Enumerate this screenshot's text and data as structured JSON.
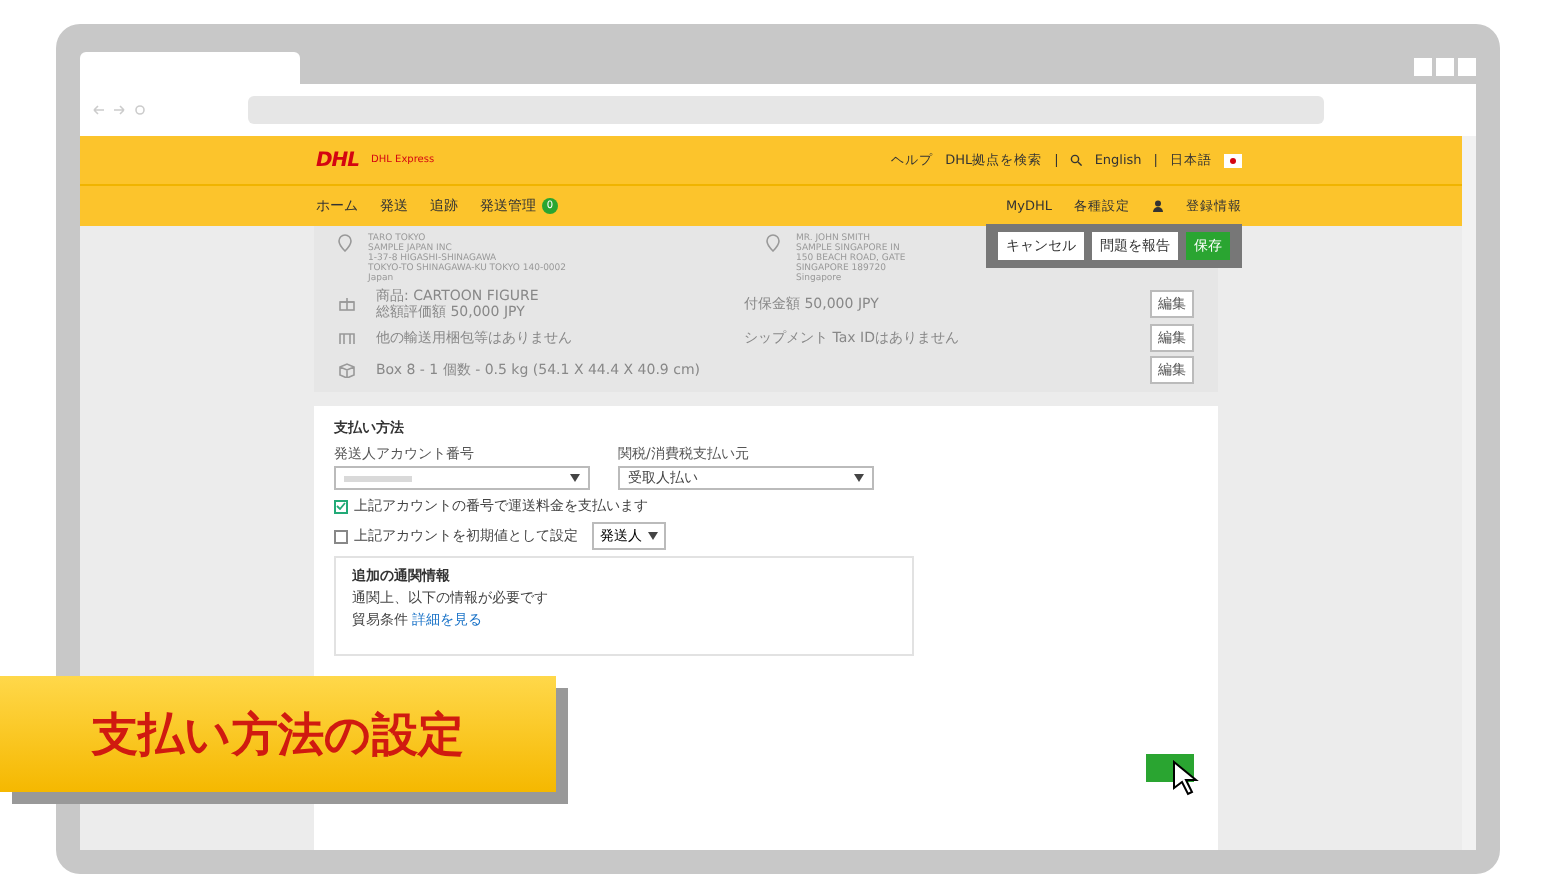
{
  "header": {
    "logo": "DHL",
    "brand": "DHL Express",
    "links": [
      {
        "text": "ヘルプ"
      },
      {
        "text": "DHL拠点を検索"
      },
      {
        "text": "|"
      },
      {
        "text": "English"
      },
      {
        "text": "|"
      },
      {
        "text": "日本語"
      }
    ]
  },
  "nav": {
    "items": [
      {
        "label": "ホーム"
      },
      {
        "label": "発送"
      },
      {
        "label": "追跡"
      },
      {
        "label": "発送管理",
        "badge": "0"
      }
    ],
    "right": [
      "MyDHL",
      "各種設定",
      "登録情報"
    ]
  },
  "actions": [
    {
      "label": "キャンセル",
      "kind": "plain"
    },
    {
      "label": "問題を報告",
      "kind": "plain"
    },
    {
      "label": "保存",
      "kind": "primary"
    }
  ],
  "from": [
    "TARO TOKYO",
    "SAMPLE JAPAN INC",
    "1-37-8 HIGASHI-SHINAGAWA",
    "TOKYO-TO SHINAGAWA-KU TOKYO 140-0002",
    "Japan"
  ],
  "to": [
    "MR. JOHN SMITH",
    "SAMPLE SINGAPORE IN",
    "150 BEACH ROAD, GATE",
    "SINGAPORE 189720",
    "Singapore"
  ],
  "summary_rows": [
    {
      "kind": "goods",
      "left": [
        "商品: CARTOON FIGURE",
        "総額評価額 50,000 JPY"
      ],
      "right": "付保金額 50,000 JPY",
      "edit": "編集"
    },
    {
      "kind": "docs",
      "left": [
        "他の輸送用梱包等はありません"
      ],
      "right": "シップメント Tax IDはありません",
      "edit": "編集"
    },
    {
      "kind": "box",
      "left": [
        "Box 8 - 1 個数 - 0.5 kg (54.1 X 44.4 X 40.9 cm)"
      ],
      "edit": "編集"
    }
  ],
  "payment": {
    "title": "支払い方法",
    "account_label": "発送人アカウント番号",
    "duty_label": "関税/消費税支払い元",
    "duty_value": "受取人払い",
    "options": [
      {
        "label": "上記アカウントの番号で運送料金を支払います",
        "checked": true
      },
      {
        "label": "上記アカウントを初期値として設定",
        "checked": false,
        "select": "発送人"
      }
    ],
    "customs": {
      "title": "追加の通関情報",
      "text": "通関上、以下の情報が必要です",
      "term_label": "貿易条件",
      "term_link": "詳細を見る"
    }
  },
  "caption": "支払い方法の設定"
}
